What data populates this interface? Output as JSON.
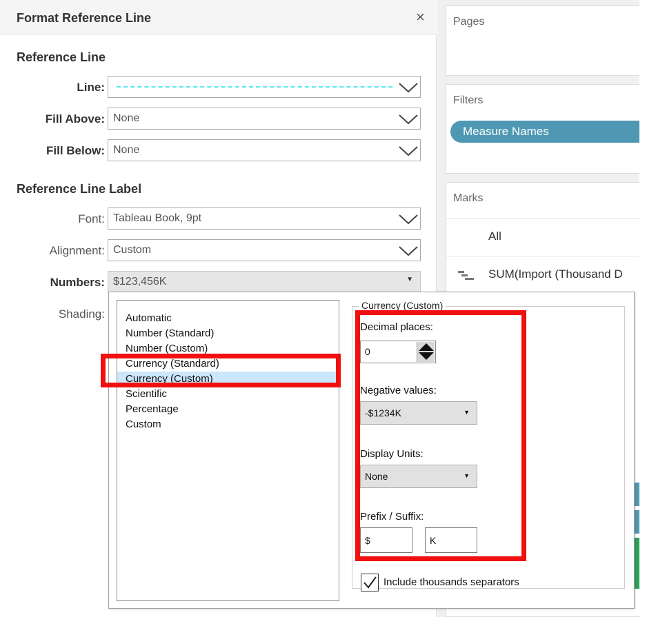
{
  "dialog": {
    "title": "Format Reference Line",
    "close": "×"
  },
  "reference_line": {
    "section_title": "Reference Line",
    "line_label": "Line:",
    "fill_above_label": "Fill Above:",
    "fill_above_value": "None",
    "fill_below_label": "Fill Below:",
    "fill_below_value": "None",
    "line_color": "#55e8f0"
  },
  "label": {
    "section_title": "Reference Line Label",
    "font_label": "Font:",
    "font_value": "Tableau Book, 9pt",
    "alignment_label": "Alignment:",
    "alignment_value": "Custom",
    "numbers_label": "Numbers:",
    "numbers_value": "$123,456K",
    "shading_label": "Shading:"
  },
  "number_format": {
    "options": [
      "Automatic",
      "Number (Standard)",
      "Number (Custom)",
      "Currency (Standard)",
      "Currency (Custom)",
      "Scientific",
      "Percentage",
      "Custom"
    ],
    "selected": "Currency (Custom)",
    "group_title": "Currency (Custom)",
    "decimal_places_label": "Decimal places:",
    "decimal_places_value": "0",
    "negative_values_label": "Negative values:",
    "negative_values_value": "-$1234K",
    "display_units_label": "Display Units:",
    "display_units_value": "None",
    "prefix_suffix_label": "Prefix / Suffix:",
    "prefix_value": "$",
    "suffix_value": "K",
    "thousands_separator_label": "Include thousands separators",
    "thousands_separator_checked": true
  },
  "shelves": {
    "pages_title": "Pages",
    "filters_title": "Filters",
    "filter_pill": "Measure Names",
    "marks_title": "Marks",
    "marks_all": "All",
    "marks_measure": "SUM(Import (Thousand D",
    "pill_color": "#4f98b3"
  },
  "highlight_color": "#f01010"
}
